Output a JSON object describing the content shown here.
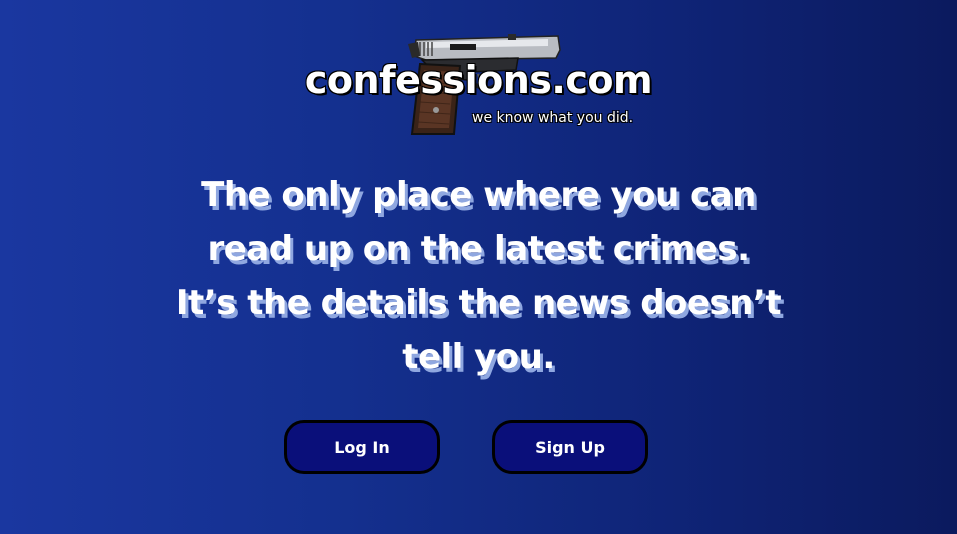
{
  "header": {
    "brand_name": "confessions.com",
    "tagline": "we know what you did.",
    "logo_icon": "pistol-icon"
  },
  "main": {
    "headline_lines": [
      "The only place where you can",
      "read up on the latest crimes.",
      "It’s the details the news doesn’t",
      "tell you."
    ]
  },
  "actions": {
    "login_label": "Log In",
    "signup_label": "Sign Up"
  },
  "colors": {
    "background_start": "#1a37a0",
    "background_end": "#0b1a5e",
    "button_fill": "#0a0f7a",
    "headline_shadow": "#8fa7e0"
  }
}
